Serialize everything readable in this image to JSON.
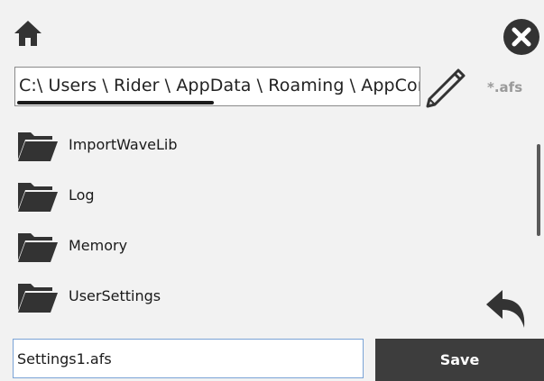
{
  "header": {
    "home_icon": "home-icon",
    "close_icon": "close-circle-icon"
  },
  "path": {
    "text": "C:\\ Users \\  Rider  \\ AppData \\ Roaming \\ AppConfig",
    "edit_icon": "pencil-icon"
  },
  "filter": {
    "label": "*.afs"
  },
  "folders": [
    {
      "label": "ImportWaveLib",
      "icon": "folder-icon"
    },
    {
      "label": "Log",
      "icon": "folder-icon"
    },
    {
      "label": "Memory",
      "icon": "folder-icon"
    },
    {
      "label": "UserSettings",
      "icon": "folder-icon"
    }
  ],
  "back": {
    "icon": "undo-arrow-icon"
  },
  "footer": {
    "filename_value": "Settings1.afs",
    "save_label": "Save"
  },
  "colors": {
    "background": "#f2f2f2",
    "icon": "#333333",
    "save_button": "#3d3d3d",
    "filter_text": "#9a9a9a"
  }
}
